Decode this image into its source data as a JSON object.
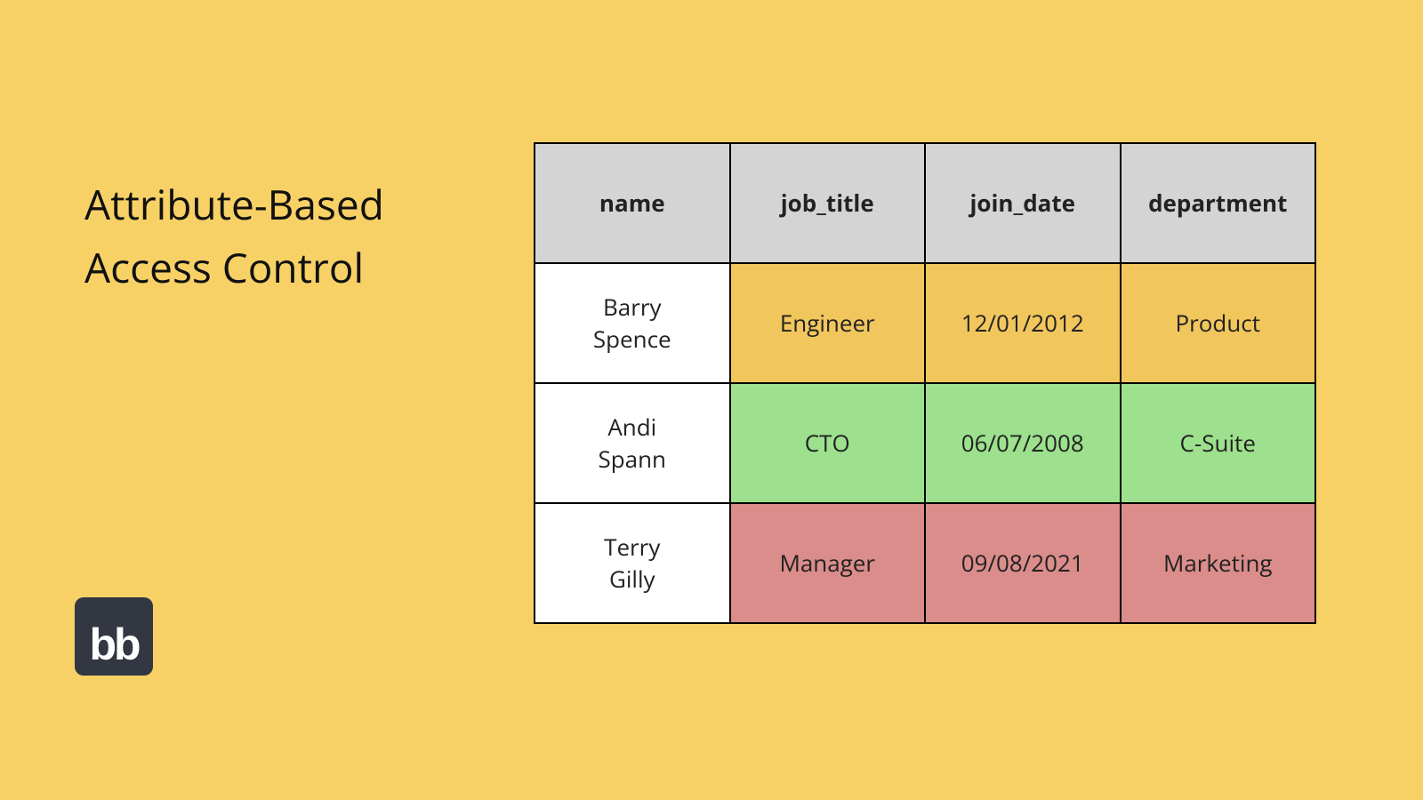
{
  "title_line1": "Attribute-Based",
  "title_line2": "Access Control",
  "logo_text": "bb",
  "table": {
    "headers": [
      "name",
      "job_title",
      "join_date",
      "department"
    ],
    "rows": [
      {
        "name_line1": "Barry",
        "name_line2": "Spence",
        "job_title": "Engineer",
        "join_date": "12/01/2012",
        "department": "Product",
        "color": "yellow"
      },
      {
        "name_line1": "Andi",
        "name_line2": "Spann",
        "job_title": "CTO",
        "join_date": "06/07/2008",
        "department": "C-Suite",
        "color": "green"
      },
      {
        "name_line1": "Terry",
        "name_line2": "Gilly",
        "job_title": "Manager",
        "join_date": "09/08/2021",
        "department": "Marketing",
        "color": "red"
      }
    ]
  },
  "chart_data": {
    "type": "table",
    "title": "Attribute-Based Access Control",
    "columns": [
      "name",
      "job_title",
      "join_date",
      "department"
    ],
    "rows": [
      {
        "name": "Barry Spence",
        "job_title": "Engineer",
        "join_date": "12/01/2012",
        "department": "Product",
        "highlight": "yellow"
      },
      {
        "name": "Andi Spann",
        "job_title": "CTO",
        "join_date": "06/07/2008",
        "department": "C-Suite",
        "highlight": "green"
      },
      {
        "name": "Terry Gilly",
        "job_title": "Manager",
        "join_date": "09/08/2021",
        "department": "Marketing",
        "highlight": "red"
      }
    ]
  }
}
